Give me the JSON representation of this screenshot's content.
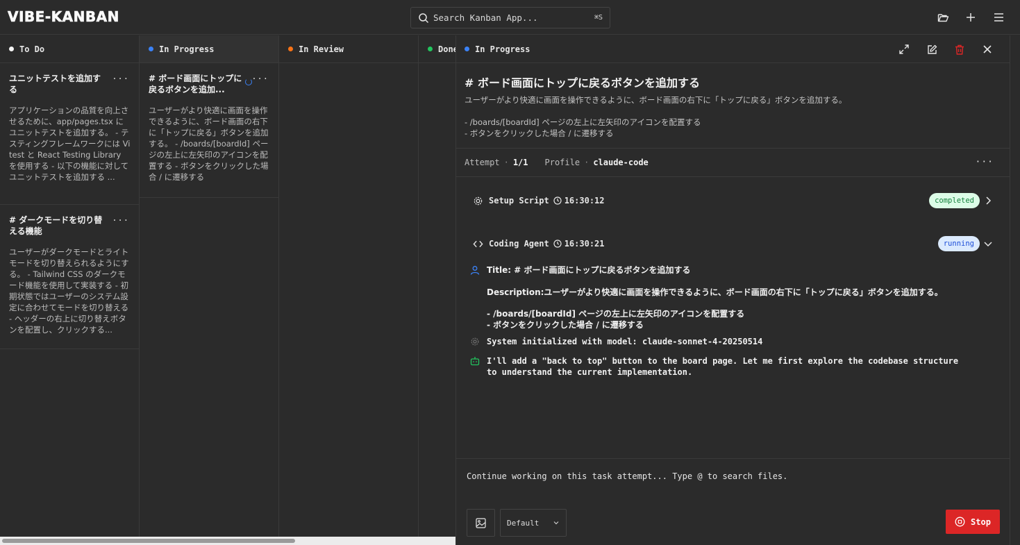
{
  "app": {
    "logo": "VIBE-KANBAN"
  },
  "search": {
    "placeholder": "Search Kanban App...",
    "shortcut": "⌘S"
  },
  "header_icons": [
    "folder-open-icon",
    "plus-icon",
    "menu-icon"
  ],
  "columns": [
    {
      "title": "To Do",
      "color": "#f5f5f5"
    },
    {
      "title": "In Progress",
      "color": "#3b82f6"
    },
    {
      "title": "In Review",
      "color": "#f97316"
    },
    {
      "title": "Done",
      "color": "#22c55e"
    }
  ],
  "todo_cards": [
    {
      "title": "ユニットテストを追加する",
      "description": "アプリケーションの品質を向上させるために、app/pages.tsx にユニットテストを追加する。 - テスティングフレームワークには Vitest と React Testing Library を使用する - 以下の機能に対してユニットテストを追加する ..."
    },
    {
      "title": "# ダークモードを切り替える機能",
      "description": "ユーザーがダークモードとライトモードを切り替えられるようにする。 - Tailwind CSS のダークモード機能を使用して実装する - 初期状態ではユーザーのシステム設定に合わせてモードを切り替える - ヘッダーの右上に切り替えボタンを配置し、クリックする..."
    }
  ],
  "inprogress_cards": [
    {
      "title": "# ボード画面にトップに戻るボタンを追加...",
      "description": "ユーザーがより快適に画面を操作できるように、ボード画面の右下に「トップに戻る」ボタンを追加する。 - /boards/[boardId] ページの左上に左矢印のアイコンを配置する - ボタンをクリックした場合 / に遷移する"
    }
  ],
  "card_more": "...",
  "panel": {
    "status": "In Progress",
    "status_color": "#3b82f6",
    "title": "# ボード画面にトップに戻るボタンを追加する",
    "description": "ユーザーがより快適に画面を操作できるように、ボード画面の右下に「トップに戻る」ボタンを追加する。",
    "bullets": [
      "- /boards/[boardId] ページの左上に左矢印のアイコンを配置する",
      "- ボタンをクリックした場合 / に遷移する"
    ],
    "attempt_label": "Attempt",
    "attempt_value": "1/1",
    "profile_label": "Profile",
    "profile_value": "claude-code",
    "dot_sep": "·",
    "more": "···"
  },
  "processes": [
    {
      "name": "Setup Script",
      "time": "16:30:12",
      "status": "completed"
    },
    {
      "name": "Coding Agent",
      "time": "16:30:21",
      "status": "running"
    }
  ],
  "log": {
    "user_title": "Title: # ボード画面にトップに戻るボタンを追加する",
    "user_description": "Description:ユーザーがより快適に画面を操作できるように、ボード画面の右下に「トップに戻る」ボタンを追加する。",
    "user_bullets": [
      "- /boards/[boardId] ページの左上に左矢印のアイコンを配置する",
      "- ボタンをクリックした場合 / に遷移する"
    ],
    "system": "System initialized with model: claude-sonnet-4-20250514",
    "assistant": "I'll add a \"back to top\" button to the board page. Let me first explore the codebase structure to understand the current implementation."
  },
  "composer": {
    "placeholder": "Continue working on this task attempt... Type @ to search files.",
    "select_value": "Default",
    "stop_label": "Stop"
  },
  "colors": {
    "user_icon": "#3b82f6",
    "assistant_icon": "#22c55e",
    "system_icon": "#777777",
    "stop": "#dc2626"
  }
}
